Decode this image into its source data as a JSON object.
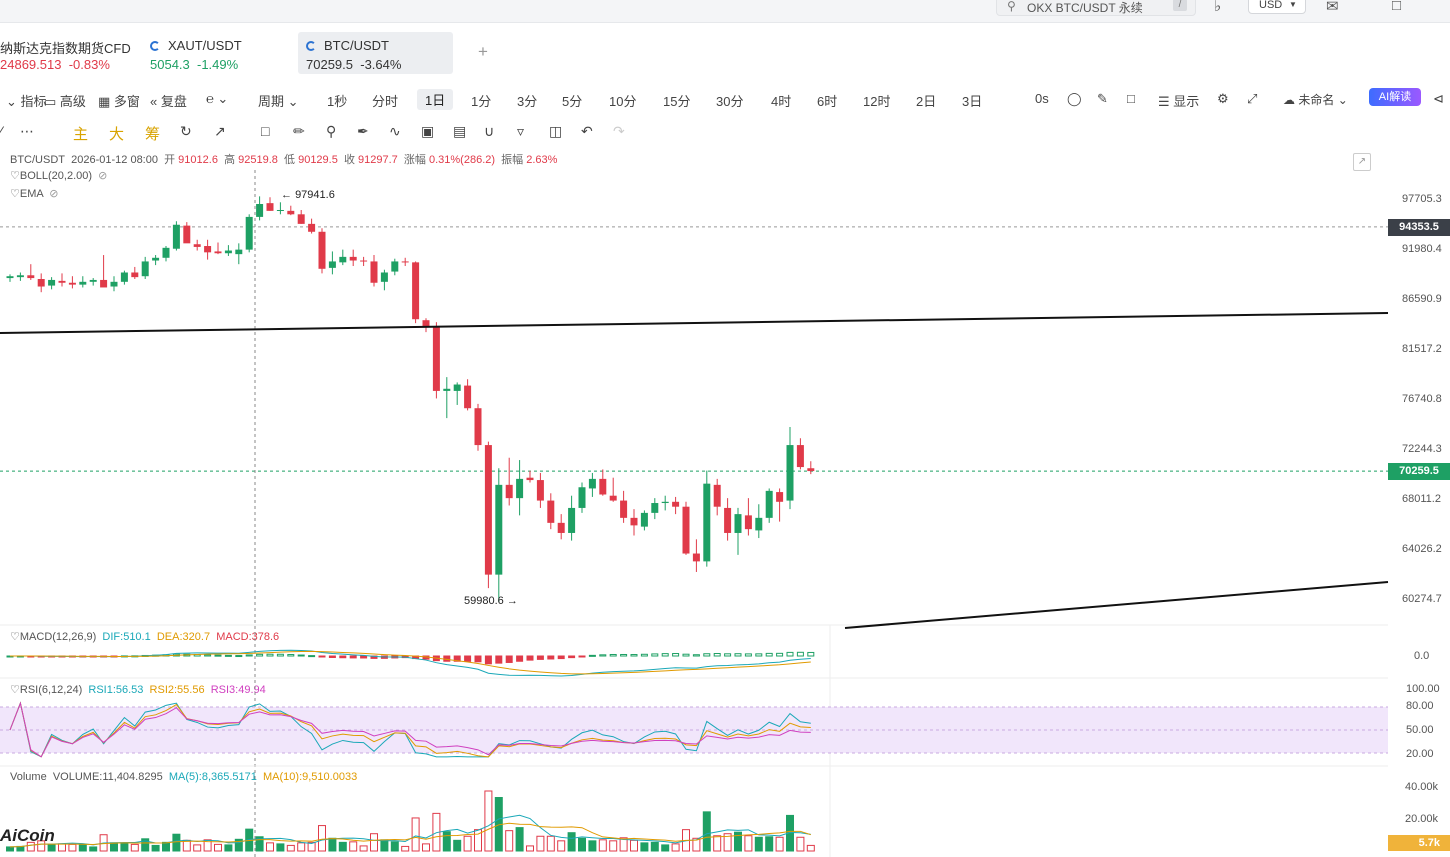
{
  "topbar": {
    "search_text": "OKX BTC/USDT 永续",
    "search_shortcut": "/",
    "currency": "USD"
  },
  "tabs": [
    {
      "name": "纳斯达克指数期货CFD",
      "price": "24869.513",
      "change": "-0.83%"
    },
    {
      "name": "XAUT/USDT",
      "price": "5054.3",
      "change": "-1.49%"
    },
    {
      "name": "BTC/USDT",
      "price": "70259.5",
      "change": "-3.64%"
    }
  ],
  "toolbar": {
    "items": [
      "指标",
      "高级",
      "多窗",
      "复盘",
      "周期"
    ],
    "periods": [
      "1秒",
      "分时",
      "1日",
      "1分",
      "3分",
      "5分",
      "10分",
      "15分",
      "30分",
      "4时",
      "6时",
      "12时",
      "2日",
      "3日"
    ],
    "active_period": "1日",
    "countdown": "0s",
    "display": "显示",
    "layout_name": "未命名",
    "ai_label": "AI解读"
  },
  "draw_tools": [
    "主",
    "大",
    "筹"
  ],
  "info": {
    "symbol": "BTC/USDT",
    "date": "2026-01-12 08:00",
    "open_label": "开",
    "open": "91012.6",
    "high_label": "高",
    "high": "92519.8",
    "low_label": "低",
    "low": "90129.5",
    "close_label": "收",
    "close": "91297.7",
    "chg_label": "涨幅",
    "chg": "0.31%(286.2)",
    "amp_label": "振幅",
    "amp": "2.63%",
    "boll": "BOLL(20,2.00)",
    "ema": "EMA"
  },
  "macd": {
    "label": "MACD(12,26,9)",
    "dif": "DIF:510.1",
    "dea": "DEA:320.7",
    "macd": "MACD:378.6"
  },
  "rsi": {
    "label": "RSI(6,12,24)",
    "rsi1": "RSI1:56.53",
    "rsi2": "RSI2:55.56",
    "rsi3": "RSI3:49.94"
  },
  "volume": {
    "label": "Volume",
    "vol": "VOLUME:11,404.8295",
    "ma5": "MA(5):8,365.5171",
    "ma10": "MA(10):9,510.0033"
  },
  "price_axis": {
    "labels": [
      "97705.3",
      "91980.4",
      "86590.9",
      "81517.2",
      "76740.8",
      "72244.3",
      "68011.2",
      "64026.2",
      "60274.7"
    ],
    "current_price": "70259.5",
    "line_price": "94353.5",
    "macd_zero": "0.0",
    "rsi_labels": [
      "100.00",
      "80.00",
      "50.00",
      "20.00"
    ],
    "vol_labels": [
      "40.00k",
      "20.00k"
    ],
    "vol_current": "5.7k"
  },
  "annotations": {
    "high_mark": "97941.6",
    "low_mark": "59980.6"
  },
  "watermark": "AiCoin",
  "colors": {
    "up": "#1ea064",
    "down": "#e03a49",
    "accent": "#2c73d2"
  },
  "chart_data": {
    "type": "candlestick",
    "candles": [
      [
        88700,
        89100,
        88300,
        88900
      ],
      [
        88800,
        89300,
        88400,
        89000
      ],
      [
        89000,
        90200,
        88500,
        88700
      ],
      [
        88600,
        89200,
        87200,
        87800
      ],
      [
        87900,
        88800,
        87500,
        88500
      ],
      [
        88400,
        89200,
        87800,
        88200
      ],
      [
        88200,
        88900,
        87600,
        88000
      ],
      [
        88000,
        88900,
        87700,
        88300
      ],
      [
        88300,
        88700,
        87900,
        88500
      ],
      [
        88500,
        91200,
        88000,
        87700
      ],
      [
        87800,
        88900,
        87300,
        88300
      ],
      [
        88300,
        89500,
        88000,
        89300
      ],
      [
        89300,
        89900,
        88600,
        88800
      ],
      [
        88900,
        91000,
        88600,
        90500
      ],
      [
        90600,
        91200,
        90100,
        90900
      ],
      [
        90900,
        92200,
        90500,
        92000
      ],
      [
        91900,
        95000,
        91700,
        94600
      ],
      [
        94500,
        94900,
        92800,
        92500
      ],
      [
        92400,
        92900,
        91700,
        92100
      ],
      [
        92200,
        92900,
        90700,
        91500
      ],
      [
        91600,
        92600,
        91300,
        91400
      ],
      [
        91400,
        92300,
        91100,
        91700
      ],
      [
        91300,
        92500,
        90200,
        91800
      ],
      [
        91800,
        95800,
        91500,
        95500
      ],
      [
        95500,
        97900,
        95100,
        97000
      ],
      [
        97100,
        97800,
        96200,
        96200
      ],
      [
        96300,
        97200,
        95800,
        96300
      ],
      [
        96200,
        96800,
        95700,
        95800
      ],
      [
        95800,
        96300,
        94700,
        94700
      ],
      [
        94700,
        95300,
        93600,
        93800
      ],
      [
        93800,
        94200,
        89200,
        89700
      ],
      [
        89800,
        91600,
        89100,
        90500
      ],
      [
        90400,
        91800,
        90100,
        91000
      ],
      [
        91000,
        91800,
        90000,
        90600
      ],
      [
        90600,
        91000,
        90000,
        90500
      ],
      [
        90500,
        91200,
        87800,
        88200
      ],
      [
        88300,
        89600,
        87400,
        89300
      ],
      [
        89400,
        90800,
        89000,
        90500
      ],
      [
        90500,
        90900,
        90000,
        90400
      ],
      [
        90400,
        90500,
        84000,
        84400
      ],
      [
        84300,
        84500,
        83100,
        83700
      ],
      [
        83700,
        84100,
        76700,
        77400
      ],
      [
        77400,
        78700,
        74900,
        77600
      ],
      [
        77400,
        78200,
        76100,
        78000
      ],
      [
        77900,
        78500,
        75600,
        75800
      ],
      [
        75800,
        76200,
        72000,
        72500
      ],
      [
        72500,
        72800,
        61000,
        62000
      ],
      [
        62000,
        70500,
        59980,
        69100
      ],
      [
        69100,
        71400,
        67400,
        68000
      ],
      [
        68000,
        71200,
        66600,
        69600
      ],
      [
        69700,
        70300,
        69300,
        69500
      ],
      [
        69500,
        70100,
        67200,
        67800
      ],
      [
        67800,
        68400,
        65500,
        66000
      ],
      [
        66000,
        66700,
        64700,
        65200
      ],
      [
        65200,
        68200,
        64600,
        67200
      ],
      [
        67200,
        69300,
        66800,
        68900
      ],
      [
        68800,
        70100,
        68100,
        69600
      ],
      [
        69600,
        70400,
        68200,
        68300
      ],
      [
        68200,
        69700,
        67700,
        67800
      ],
      [
        67800,
        68600,
        66000,
        66400
      ],
      [
        66400,
        67100,
        65000,
        65800
      ],
      [
        65700,
        67000,
        65400,
        66800
      ],
      [
        66800,
        68000,
        66300,
        67600
      ],
      [
        67600,
        68200,
        67000,
        67700
      ],
      [
        67700,
        68100,
        66700,
        67300
      ],
      [
        67300,
        67700,
        63500,
        63600
      ],
      [
        63600,
        64700,
        62200,
        63000
      ],
      [
        63000,
        70300,
        62600,
        69200
      ],
      [
        69100,
        69600,
        66600,
        67300
      ],
      [
        67200,
        68000,
        64600,
        65200
      ],
      [
        65200,
        67200,
        63500,
        66700
      ],
      [
        66600,
        68000,
        65000,
        65500
      ],
      [
        65400,
        67500,
        64800,
        66400
      ],
      [
        66400,
        68800,
        66000,
        68600
      ],
      [
        68500,
        68800,
        66100,
        67700
      ],
      [
        67800,
        74100,
        67100,
        72500
      ],
      [
        72500,
        73100,
        70400,
        70600
      ],
      [
        70500,
        71100,
        70000,
        70260
      ]
    ]
  }
}
